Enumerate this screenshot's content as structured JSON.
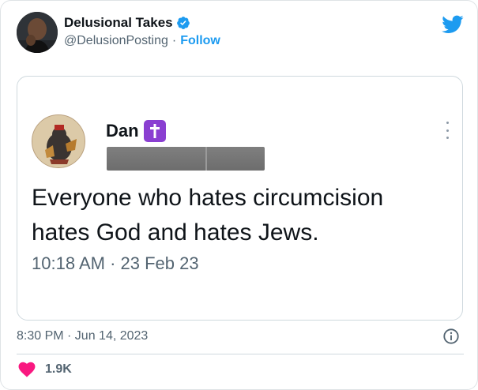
{
  "author": {
    "name": "Delusional Takes",
    "handle": "@DelusionPosting",
    "separator": "·",
    "follow_label": "Follow"
  },
  "quoted": {
    "name": "Dan",
    "text_line1": "Everyone who hates circumcision",
    "text_line2": "hates God and hates Jews.",
    "time": "10:18 AM · 23 Feb 23"
  },
  "footer": {
    "timestamp": "8:30 PM · Jun 14, 2023",
    "likes": "1.9K"
  },
  "colors": {
    "accent": "#1d9bf0",
    "like": "#f91880",
    "badge": "#8a3fd1"
  },
  "icons": [
    "verified-badge-icon",
    "twitter-bird-icon",
    "cross-emoji-icon",
    "more-options-icon",
    "info-icon",
    "heart-icon"
  ]
}
